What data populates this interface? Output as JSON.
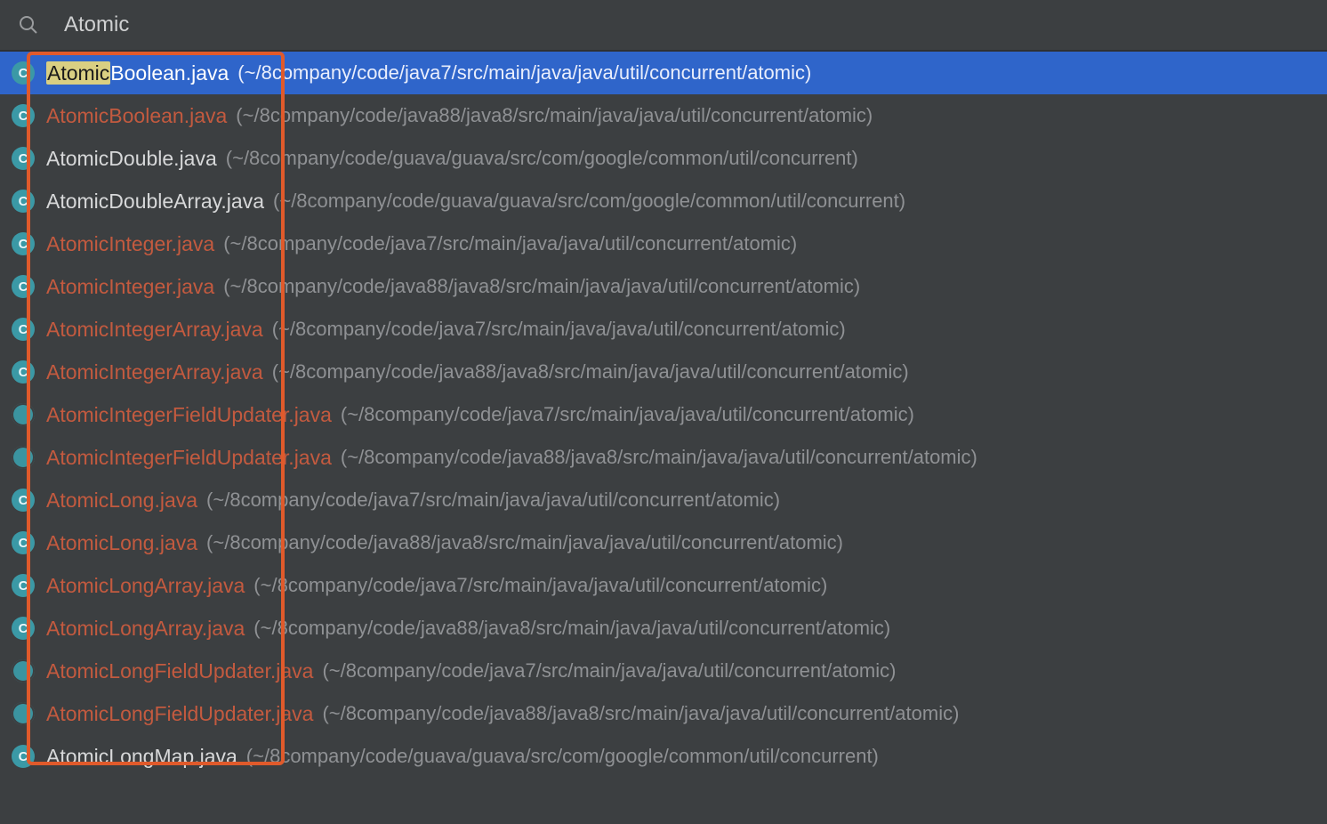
{
  "search": {
    "value": "Atomic",
    "placeholder": ""
  },
  "selectedIndex": 0,
  "results": [
    {
      "filename": "AtomicBoolean.java",
      "match": "Atomic",
      "rest": "Boolean.java",
      "path": "(~/8company/code/java7/src/main/java/java/util/concurrent/atomic)",
      "color": "white",
      "abstract": false
    },
    {
      "filename": "AtomicBoolean.java",
      "match": "Atomic",
      "rest": "Boolean.java",
      "path": "(~/8company/code/java88/java8/src/main/java/java/util/concurrent/atomic)",
      "color": "vcs",
      "abstract": false
    },
    {
      "filename": "AtomicDouble.java",
      "match": "Atomic",
      "rest": "Double.java",
      "path": "(~/8company/code/guava/guava/src/com/google/common/util/concurrent)",
      "color": "white",
      "abstract": false
    },
    {
      "filename": "AtomicDoubleArray.java",
      "match": "Atomic",
      "rest": "DoubleArray.java",
      "path": "(~/8company/code/guava/guava/src/com/google/common/util/concurrent)",
      "color": "white",
      "abstract": false
    },
    {
      "filename": "AtomicInteger.java",
      "match": "Atomic",
      "rest": "Integer.java",
      "path": "(~/8company/code/java7/src/main/java/java/util/concurrent/atomic)",
      "color": "vcs",
      "abstract": false
    },
    {
      "filename": "AtomicInteger.java",
      "match": "Atomic",
      "rest": "Integer.java",
      "path": "(~/8company/code/java88/java8/src/main/java/java/util/concurrent/atomic)",
      "color": "vcs",
      "abstract": false
    },
    {
      "filename": "AtomicIntegerArray.java",
      "match": "Atomic",
      "rest": "IntegerArray.java",
      "path": "(~/8company/code/java7/src/main/java/java/util/concurrent/atomic)",
      "color": "vcs",
      "abstract": false
    },
    {
      "filename": "AtomicIntegerArray.java",
      "match": "Atomic",
      "rest": "IntegerArray.java",
      "path": "(~/8company/code/java88/java8/src/main/java/java/util/concurrent/atomic)",
      "color": "vcs",
      "abstract": false
    },
    {
      "filename": "AtomicIntegerFieldUpdater.java",
      "match": "Atomic",
      "rest": "IntegerFieldUpdater.java",
      "path": "(~/8company/code/java7/src/main/java/java/util/concurrent/atomic)",
      "color": "vcs",
      "abstract": true
    },
    {
      "filename": "AtomicIntegerFieldUpdater.java",
      "match": "Atomic",
      "rest": "IntegerFieldUpdater.java",
      "path": "(~/8company/code/java88/java8/src/main/java/java/util/concurrent/atomic)",
      "color": "vcs",
      "abstract": true
    },
    {
      "filename": "AtomicLong.java",
      "match": "Atomic",
      "rest": "Long.java",
      "path": "(~/8company/code/java7/src/main/java/java/util/concurrent/atomic)",
      "color": "vcs",
      "abstract": false
    },
    {
      "filename": "AtomicLong.java",
      "match": "Atomic",
      "rest": "Long.java",
      "path": "(~/8company/code/java88/java8/src/main/java/java/util/concurrent/atomic)",
      "color": "vcs",
      "abstract": false
    },
    {
      "filename": "AtomicLongArray.java",
      "match": "Atomic",
      "rest": "LongArray.java",
      "path": "(~/8company/code/java7/src/main/java/java/util/concurrent/atomic)",
      "color": "vcs",
      "abstract": false
    },
    {
      "filename": "AtomicLongArray.java",
      "match": "Atomic",
      "rest": "LongArray.java",
      "path": "(~/8company/code/java88/java8/src/main/java/java/util/concurrent/atomic)",
      "color": "vcs",
      "abstract": false
    },
    {
      "filename": "AtomicLongFieldUpdater.java",
      "match": "Atomic",
      "rest": "LongFieldUpdater.java",
      "path": "(~/8company/code/java7/src/main/java/java/util/concurrent/atomic)",
      "color": "vcs",
      "abstract": true
    },
    {
      "filename": "AtomicLongFieldUpdater.java",
      "match": "Atomic",
      "rest": "LongFieldUpdater.java",
      "path": "(~/8company/code/java88/java8/src/main/java/java/util/concurrent/atomic)",
      "color": "vcs",
      "abstract": true
    },
    {
      "filename": "AtomicLongMap.java",
      "match": "Atomic",
      "rest": "LongMap.java",
      "path": "(~/8company/code/guava/guava/src/com/google/common/util/concurrent)",
      "color": "white",
      "abstract": false
    }
  ]
}
